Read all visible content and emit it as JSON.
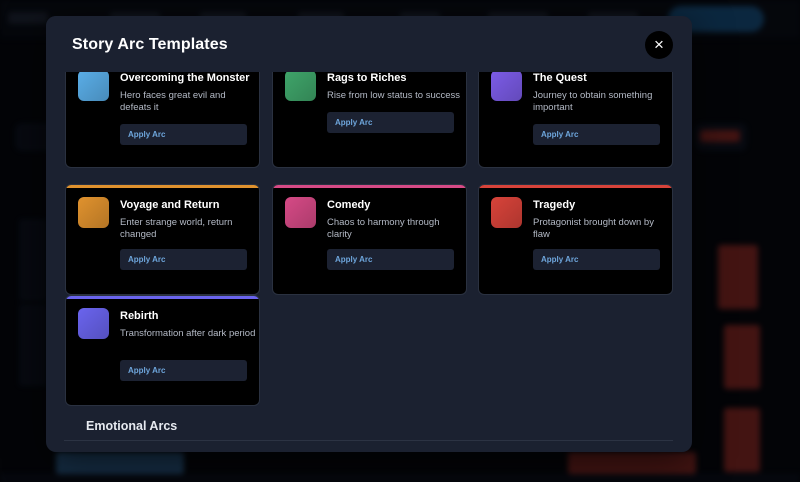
{
  "modal": {
    "title": "Story Arc Templates",
    "close_label": "×"
  },
  "cards": [
    {
      "title": "Overcoming the Monster",
      "desc": "Hero faces great evil and defeats it",
      "apply": "Apply Arc",
      "color": "#5aaee8",
      "top": "#5aaee8"
    },
    {
      "title": "Rags to Riches",
      "desc": "Rise from low status to success",
      "apply": "Apply Arc",
      "color": "#3fa56a",
      "top": "#3fa56a"
    },
    {
      "title": "The Quest",
      "desc": "Journey to obtain something important",
      "apply": "Apply Arc",
      "color": "#7c5ce8",
      "top": "#7c5ce8"
    },
    {
      "title": "Voyage and Return",
      "desc": "Enter strange world, return changed",
      "apply": "Apply Arc",
      "color": "#e0922e",
      "top": "#e0922e"
    },
    {
      "title": "Comedy",
      "desc": "Chaos to harmony through clarity",
      "apply": "Apply Arc",
      "color": "#d64a86",
      "top": "#d64a86"
    },
    {
      "title": "Tragedy",
      "desc": "Protagonist brought down by flaw",
      "apply": "Apply Arc",
      "color": "#d8433a",
      "top": "#d8433a"
    },
    {
      "title": "Rebirth",
      "desc": "Transformation after dark period",
      "apply": "Apply Arc",
      "color": "#6a64ee",
      "top": "#6a64ee"
    }
  ],
  "sections": {
    "emotional_title": "Emotional Arcs"
  },
  "peek_colors": [
    "#3fb08a",
    "#e0732e",
    "#5a9ad8"
  ]
}
